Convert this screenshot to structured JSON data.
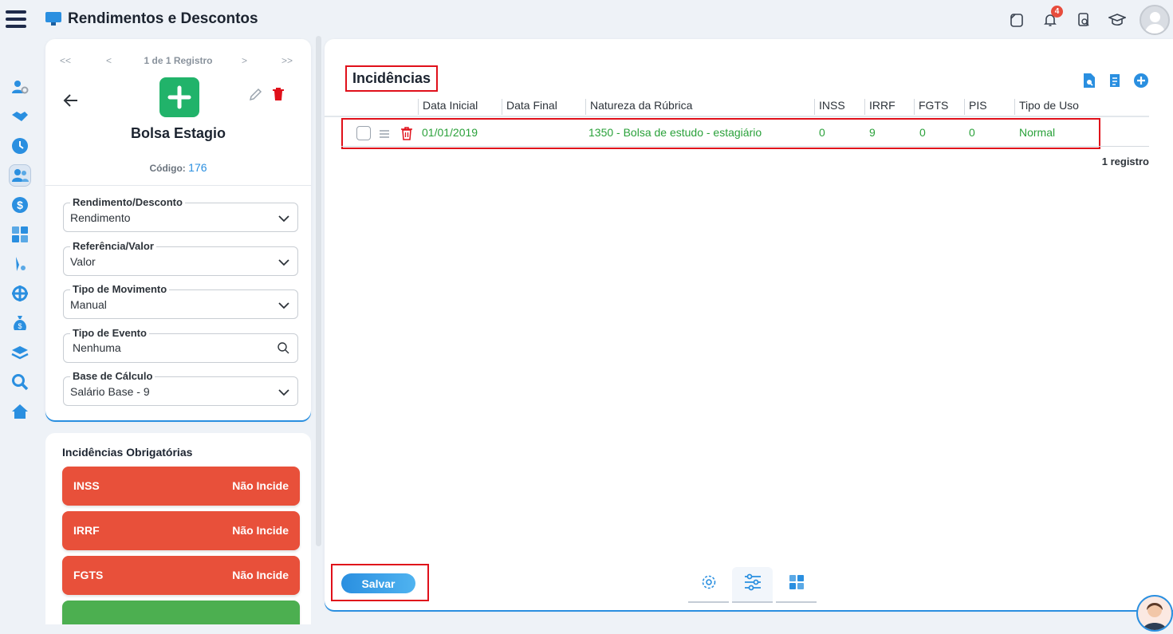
{
  "app": {
    "title": "Rendimentos e Descontos",
    "notification_count": "4"
  },
  "pager": {
    "first": "<<",
    "prev": "<",
    "info": "1 de 1 Registro",
    "next": ">",
    "last": ">>"
  },
  "record": {
    "name": "Bolsa Estagio",
    "code_label": "Código:",
    "code_value": "176"
  },
  "fields": {
    "rend_desc": {
      "label": "Rendimento/Desconto",
      "value": "Rendimento"
    },
    "ref_valor": {
      "label": "Referência/Valor",
      "value": "Valor"
    },
    "tipo_mov": {
      "label": "Tipo de Movimento",
      "value": "Manual"
    },
    "tipo_evento": {
      "label": "Tipo de Evento",
      "value": "Nenhuma"
    },
    "base_calc": {
      "label": "Base de Cálculo",
      "value": "Salário Base - 9"
    }
  },
  "incidencias_obrigatorias": {
    "title": "Incidências Obrigatórias",
    "items": [
      {
        "name": "INSS",
        "status": "Não Incide"
      },
      {
        "name": "IRRF",
        "status": "Não Incide"
      },
      {
        "name": "FGTS",
        "status": "Não Incide"
      }
    ]
  },
  "main": {
    "title": "Incidências",
    "columns": [
      "Data Inicial",
      "Data Final",
      "Natureza da Rúbrica",
      "INSS",
      "IRRF",
      "FGTS",
      "PIS",
      "Tipo de Uso"
    ],
    "rows": [
      {
        "data_inicial": "01/01/2019",
        "data_final": "",
        "natureza": "1350 - Bolsa de estudo - estagiário",
        "inss": "0",
        "irrf": "9",
        "fgts": "0",
        "pis": "0",
        "tipo_uso": "Normal"
      }
    ],
    "count": "1 registro",
    "save_label": "Salvar"
  },
  "colors": {
    "accent": "#2a8fe0",
    "green": "#21b36a",
    "danger": "#e8503a",
    "highlight": "#e0101a"
  },
  "icons": [
    "menu-icon",
    "monitor-icon",
    "copy-icon",
    "bell-icon",
    "search-document-icon",
    "graduation-cap-icon",
    "user-avatar-icon",
    "settings-icon",
    "sliders-icon",
    "calculator-icon"
  ]
}
